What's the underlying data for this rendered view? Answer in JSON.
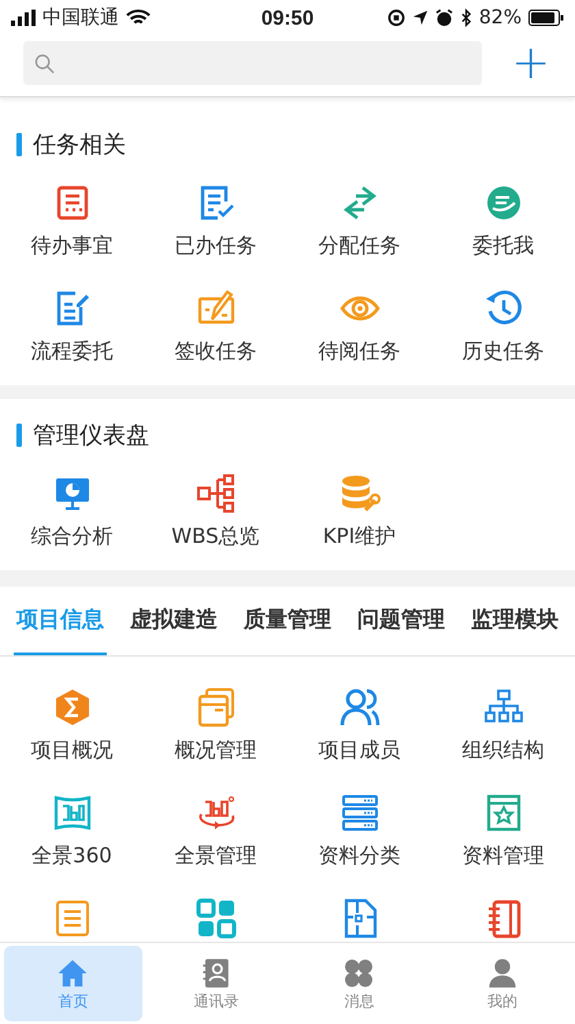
{
  "status_bar": {
    "carrier": "中国联通",
    "time": "09:50",
    "battery": "82%"
  },
  "add_button": {
    "label": "+"
  },
  "sections": [
    {
      "title": "任务相关",
      "items": [
        {
          "label": "待办事宜"
        },
        {
          "label": "已办任务"
        },
        {
          "label": "分配任务"
        },
        {
          "label": "委托我"
        },
        {
          "label": "流程委托"
        },
        {
          "label": "签收任务"
        },
        {
          "label": "待阅任务"
        },
        {
          "label": "历史任务"
        }
      ]
    },
    {
      "title": "管理仪表盘",
      "items": [
        {
          "label": "综合分析"
        },
        {
          "label": "WBS总览"
        },
        {
          "label": "KPI维护"
        }
      ]
    }
  ],
  "module_tabs": [
    {
      "label": "项目信息",
      "selected": true
    },
    {
      "label": "虚拟建造",
      "selected": false
    },
    {
      "label": "质量管理",
      "selected": false
    },
    {
      "label": "问题管理",
      "selected": false
    },
    {
      "label": "监理模块",
      "selected": false
    }
  ],
  "module_items": [
    {
      "kind": "tile",
      "label": "项目概况"
    },
    {
      "kind": "tile",
      "label": "概况管理"
    },
    {
      "kind": "tile",
      "label": "项目成员"
    },
    {
      "kind": "tile",
      "label": "组织结构"
    },
    {
      "kind": "tile",
      "label": "全景360"
    },
    {
      "kind": "tile",
      "label": "全景管理"
    },
    {
      "kind": "tile",
      "label": "资料分类"
    },
    {
      "kind": "tile",
      "label": "资料管理"
    },
    {
      "kind": "partial"
    },
    {
      "kind": "partial"
    },
    {
      "kind": "partial"
    },
    {
      "kind": "partial"
    }
  ],
  "tab_bar": [
    {
      "label": "首页",
      "selected": true
    },
    {
      "label": "通讯录",
      "selected": false
    },
    {
      "label": "消息",
      "selected": false
    },
    {
      "label": "我的",
      "selected": false
    }
  ]
}
